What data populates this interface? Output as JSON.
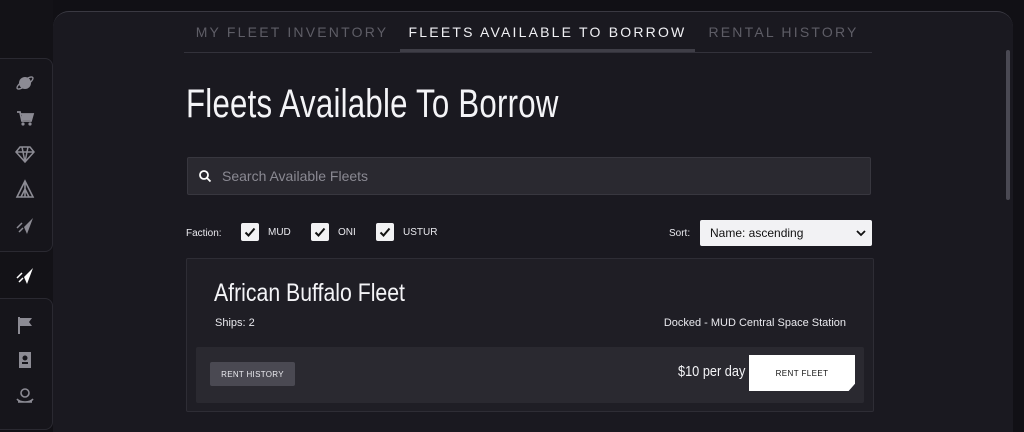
{
  "sidebar": {
    "icons": [
      "planet-icon",
      "cart-icon",
      "diamond-icon",
      "tent-icon",
      "ship-icon",
      "ship-active-icon",
      "flag-icon",
      "badge-icon",
      "wreath-icon"
    ]
  },
  "tabs": [
    {
      "label": "MY FLEET INVENTORY"
    },
    {
      "label": "FLEETS AVAILABLE TO BORROW",
      "active": true
    },
    {
      "label": "RENTAL HISTORY"
    }
  ],
  "page": {
    "title": "Fleets Available To Borrow"
  },
  "search": {
    "placeholder": "Search Available Fleets",
    "value": ""
  },
  "filters": {
    "faction_label": "Faction:",
    "factions": [
      {
        "label": "MUD",
        "checked": true
      },
      {
        "label": "ONI",
        "checked": true
      },
      {
        "label": "USTUR",
        "checked": true
      }
    ],
    "sort_label": "Sort:",
    "sort_value": "Name: ascending"
  },
  "fleets": [
    {
      "name": "African Buffalo Fleet",
      "ships": "Ships: 2",
      "status": "Docked - MUD Central Space Station",
      "price": "$10 per day",
      "history_button": "RENT HISTORY",
      "rent_button": "RENT FLEET"
    }
  ],
  "colors": {
    "background": "#111015",
    "panel": "#1a1920",
    "accent": "#ffffff"
  }
}
